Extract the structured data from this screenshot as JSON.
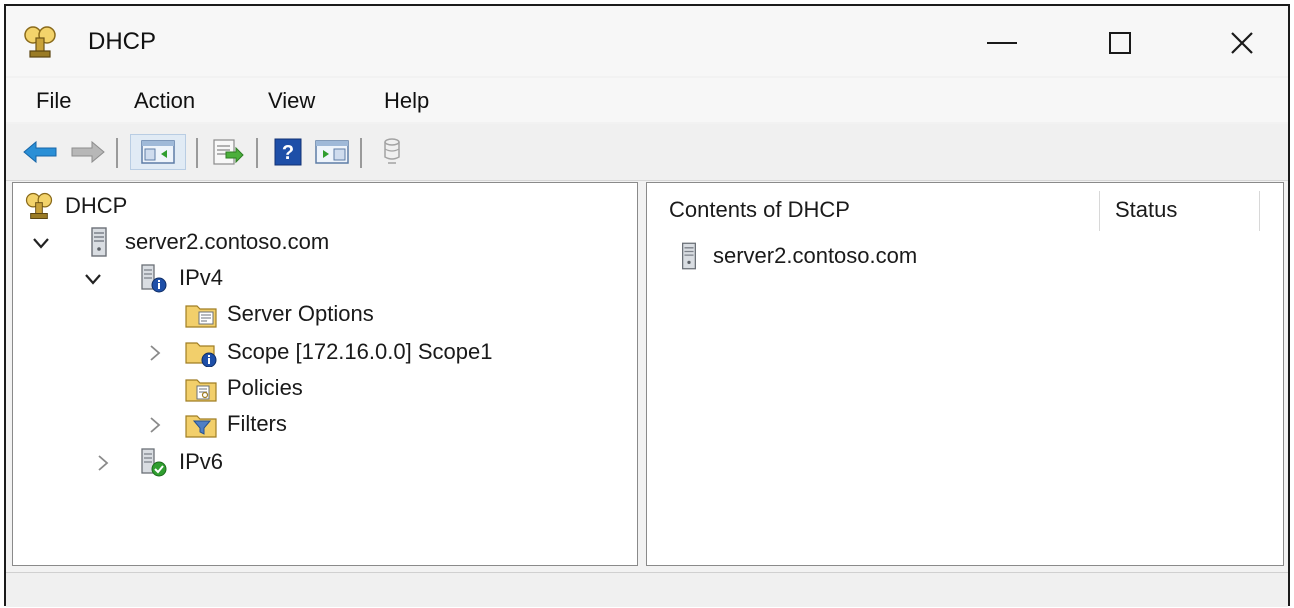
{
  "window": {
    "title": "DHCP"
  },
  "menu": [
    "File",
    "Action",
    "View",
    "Help"
  ],
  "toolbar": {
    "buttons": [
      "back-arrow",
      "forward-arrow",
      "show-hide-console-tree",
      "export-list",
      "help",
      "show-hide-action-pane",
      "database"
    ]
  },
  "tree": {
    "root": "DHCP",
    "server": "server2.contoso.com",
    "ipv4": "IPv4",
    "server_options": "Server Options",
    "scope": "Scope [172.16.0.0] Scope1",
    "policies": "Policies",
    "filters": "Filters",
    "ipv6": "IPv6"
  },
  "content": {
    "columns": [
      "Contents of DHCP",
      "Status"
    ],
    "rows": [
      {
        "name": "server2.contoso.com",
        "status": ""
      }
    ]
  },
  "colors": {
    "accent_blue": "#2a8fd6",
    "ok_green": "#2f9e2f",
    "info_blue": "#1e4fa8"
  }
}
